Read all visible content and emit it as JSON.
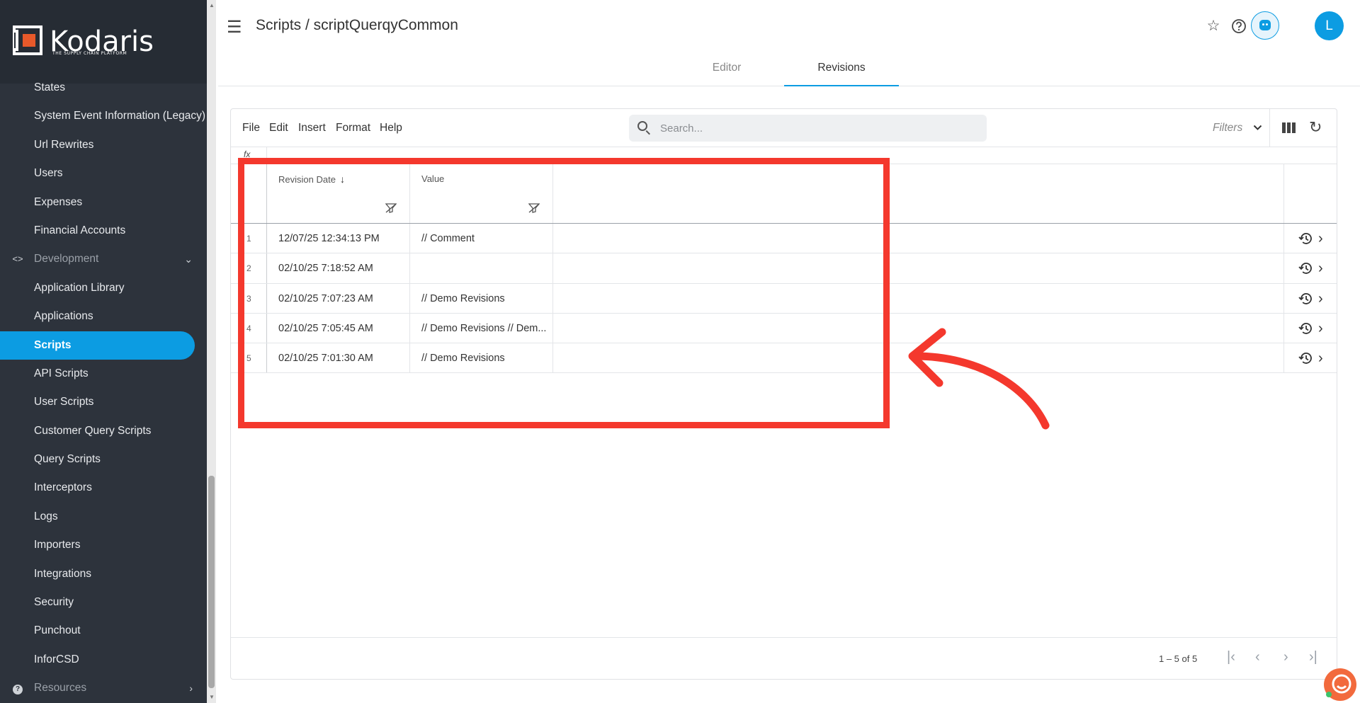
{
  "brand": {
    "name": "Kodaris",
    "tagline": "THE SUPPLY CHAIN PLATFORM"
  },
  "sidebar": {
    "items": [
      {
        "label": "States"
      },
      {
        "label": "System Event Information (Legacy)"
      },
      {
        "label": "Url Rewrites"
      },
      {
        "label": "Users"
      },
      {
        "label": "Expenses"
      },
      {
        "label": "Financial Accounts"
      },
      {
        "label": "Development",
        "lead_icon": "<>",
        "trail_icon": "⌄"
      },
      {
        "label": "Application Library"
      },
      {
        "label": "Applications"
      },
      {
        "label": "Scripts"
      },
      {
        "label": "API Scripts"
      },
      {
        "label": "User Scripts"
      },
      {
        "label": "Customer Query Scripts"
      },
      {
        "label": "Query Scripts"
      },
      {
        "label": "Interceptors"
      },
      {
        "label": "Logs"
      },
      {
        "label": "Importers"
      },
      {
        "label": "Integrations"
      },
      {
        "label": "Security"
      },
      {
        "label": "Punchout"
      },
      {
        "label": "InforCSD"
      },
      {
        "label": "Resources",
        "lead_icon": "?",
        "trail_icon": "›"
      }
    ],
    "active_item": "Scripts"
  },
  "header": {
    "title": "Scripts / scriptQuerqyCommon",
    "avatar_initial": "L",
    "tabs": [
      {
        "label": "Editor"
      },
      {
        "label": "Revisions"
      }
    ],
    "active_tab": "Revisions"
  },
  "toolbar": {
    "menus": [
      "File",
      "Edit",
      "Insert",
      "Format",
      "Help"
    ],
    "search_placeholder": "Search...",
    "filters_label": "Filters"
  },
  "formula_bar": {
    "fx_label": "fx"
  },
  "grid": {
    "columns": [
      "Revision Date",
      "Value"
    ],
    "sort": {
      "column": "Revision Date",
      "direction": "descending"
    },
    "rows": [
      {
        "num": "1",
        "date": "12/07/25 12:34:13 PM",
        "value": "// Comment"
      },
      {
        "num": "2",
        "date": "02/10/25 7:18:52 AM",
        "value": ""
      },
      {
        "num": "3",
        "date": "02/10/25 7:07:23 AM",
        "value": "// Demo Revisions"
      },
      {
        "num": "4",
        "date": "02/10/25 7:05:45 AM",
        "value": "// Demo Revisions // Dem..."
      },
      {
        "num": "5",
        "date": "02/10/25 7:01:30 AM",
        "value": "// Demo Revisions"
      }
    ]
  },
  "pagination": {
    "range_label": "1 – 5 of 5"
  },
  "colors": {
    "accent": "#0c9ce2",
    "sidebar_bg": "#2d333c",
    "annotation": "#f4382d",
    "brand_orange": "#e8592a"
  }
}
